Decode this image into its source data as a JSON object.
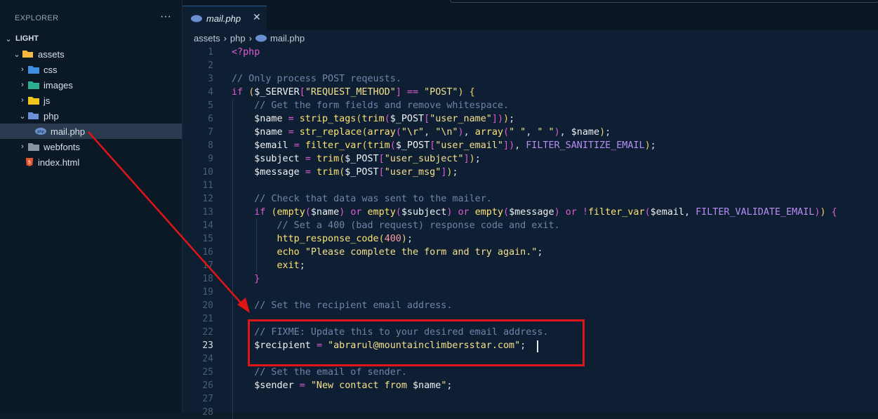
{
  "explorer": {
    "title": "EXPLORER",
    "more": "···",
    "root": "LIGHT",
    "tree": [
      {
        "label": "assets",
        "kind": "folder-open",
        "depth": 1
      },
      {
        "label": "css",
        "kind": "folder",
        "depth": 2
      },
      {
        "label": "images",
        "kind": "folder",
        "depth": 2
      },
      {
        "label": "js",
        "kind": "folder",
        "depth": 2
      },
      {
        "label": "php",
        "kind": "folder-open",
        "depth": 2
      },
      {
        "label": "mail.php",
        "kind": "file-php",
        "depth": 3
      },
      {
        "label": "webfonts",
        "kind": "folder",
        "depth": 2
      },
      {
        "label": "index.html",
        "kind": "file-html",
        "depth": 1
      }
    ]
  },
  "tab": {
    "label": "mail.php",
    "close": "✕"
  },
  "breadcrumb": {
    "part1": "assets",
    "part2": "php",
    "part3": "mail.php"
  },
  "code": {
    "line_numbers": [
      "1",
      "2",
      "3",
      "4",
      "5",
      "6",
      "7",
      "8",
      "9",
      "10",
      "11",
      "12",
      "13",
      "14",
      "15",
      "16",
      "17",
      "18",
      "19",
      "20",
      "21",
      "22",
      "23",
      "24",
      "25",
      "26",
      "27",
      "28"
    ],
    "active_line": "23"
  },
  "colors": {
    "accent": "#e01515",
    "background": "#0e1f33"
  }
}
